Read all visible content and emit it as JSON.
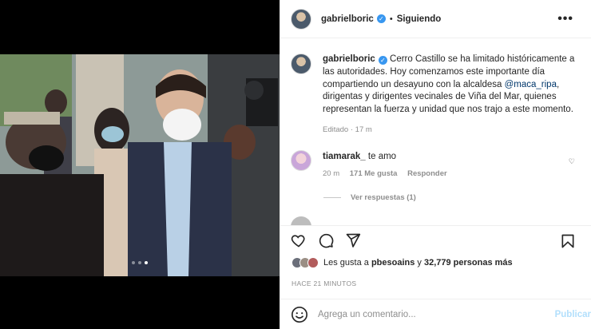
{
  "post": {
    "username": "gabrielboric",
    "separator": "•",
    "follow_status": "Siguiendo",
    "more_glyph": "•••",
    "photo_dots": [
      false,
      false,
      true
    ]
  },
  "caption": {
    "username": "gabrielboric",
    "text_before": " Cerro Castillo se ha limitado históricamente a las autoridades. Hoy comenzamos este importante día compartiendo un desayuno con la alcaldesa ",
    "mention": "@maca_ripa",
    "text_after": ", dirigentas y dirigentes vecinales de Viña del Mar, quienes representan la fuerza y unidad que nos trajo a este momento.",
    "meta": "Editado · 17 m"
  },
  "comment": {
    "username": "tiamarak_",
    "text": " te amo",
    "time": "20 m",
    "likes": "171 Me gusta",
    "reply": "Responder",
    "view_replies": "Ver respuestas (1)"
  },
  "likes": {
    "prefix": "Les gusta a ",
    "user": "pbesoains",
    "middle": " y ",
    "count": "32,779 personas más"
  },
  "timestamp": "HACE 21 MINUTOS",
  "add_comment": {
    "placeholder": "Agrega un comentario...",
    "publish": "Publicar"
  },
  "colors": {
    "verified": "#3897f0",
    "link": "#00376b",
    "publish_disabled": "#b2dffc"
  }
}
